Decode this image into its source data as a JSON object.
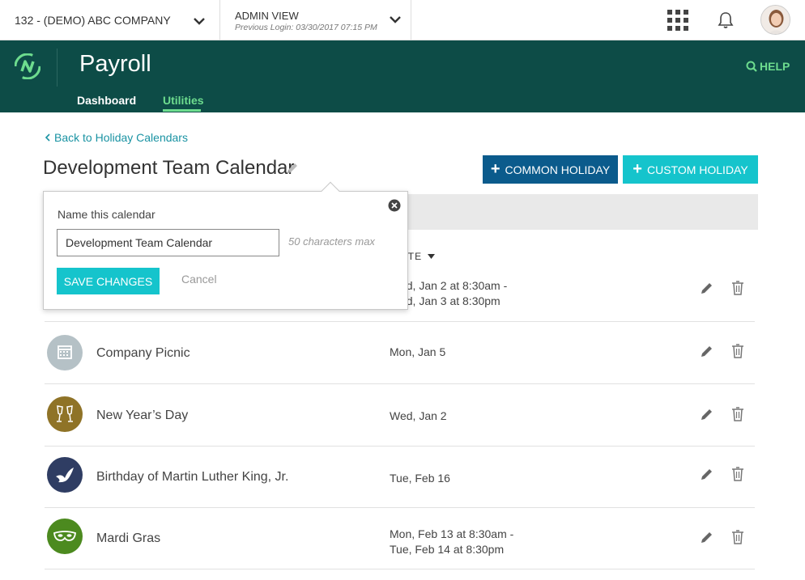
{
  "topbar": {
    "company": "132 - (DEMO) ABC COMPANY",
    "view_title": "ADMIN VIEW",
    "previous_login": "Previous Login: 03/30/2017 07:15 PM"
  },
  "header": {
    "app_title": "Payroll",
    "help": "HELP",
    "tabs": [
      {
        "label": "Dashboard"
      },
      {
        "label": "Utilities"
      }
    ]
  },
  "main": {
    "back_link": "Back to Holiday Calendars",
    "title": "Development Team Calendar",
    "btn_common": "COMMON HOLIDAY",
    "btn_custom": "CUSTOM HOLIDAY",
    "date_column": "DATE"
  },
  "popover": {
    "label": "Name this calendar",
    "input_value": "Development Team Calendar",
    "hint": "50 characters max",
    "save": "SAVE CHANGES",
    "cancel": "Cancel"
  },
  "rows": [
    {
      "name": "",
      "date_line1": "Wed, Jan 2 at 8:30am -",
      "date_line2": "Wed, Jan 3 at 8:30pm"
    },
    {
      "name": "Company Picnic",
      "date_line1": "Mon, Jan 5",
      "date_line2": ""
    },
    {
      "name": "New Year’s Day",
      "date_line1": "Wed, Jan 2",
      "date_line2": ""
    },
    {
      "name": "Birthday of Martin Luther King, Jr.",
      "date_line1": "Tue, Feb 16",
      "date_line2": ""
    },
    {
      "name": "Mardi Gras",
      "date_line1": "Mon, Feb 13 at 8:30am -",
      "date_line2": "Tue, Feb 14 at 8:30pm"
    }
  ],
  "colors": {
    "header_bg": "#0d4c47",
    "accent_green": "#6ddc8e",
    "primary_blue": "#0b5b8c",
    "teal": "#15c4cc",
    "link": "#1a93a3"
  }
}
